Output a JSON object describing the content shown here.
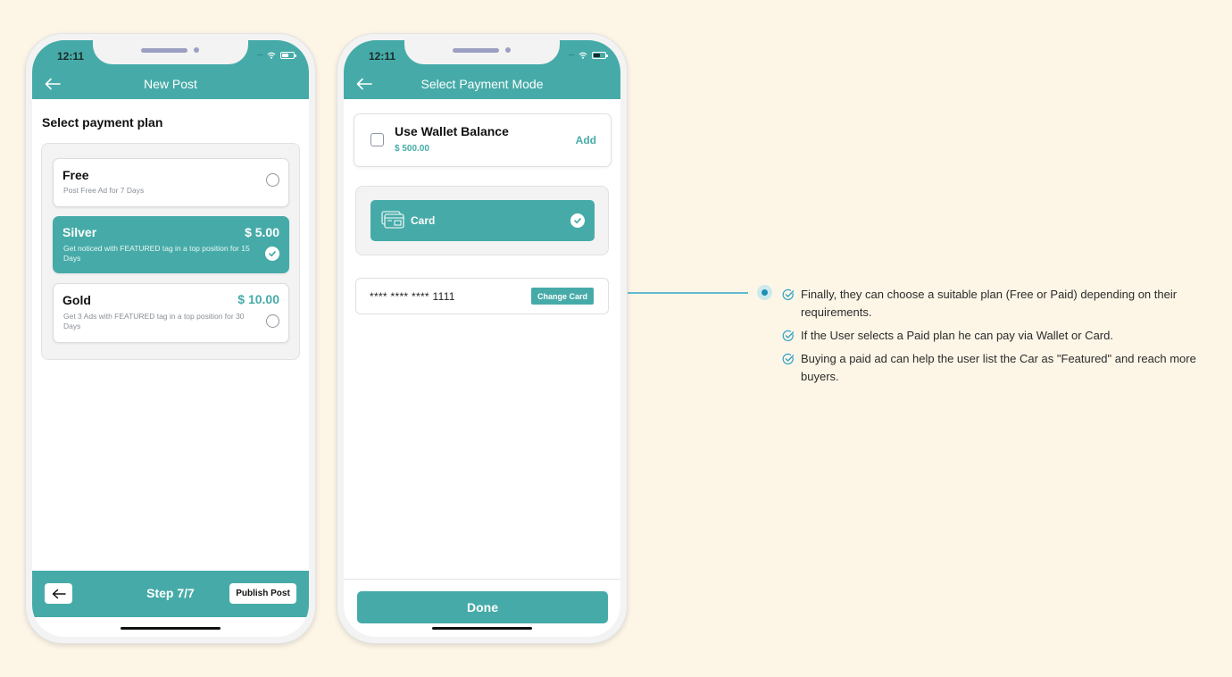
{
  "phone1": {
    "status_time": "12:11",
    "nav_title": "New Post",
    "section_title": "Select payment plan",
    "plans": [
      {
        "name": "Free",
        "price": "",
        "description": "Post Free Ad for 7 Days",
        "selected": false
      },
      {
        "name": "Silver",
        "price": "$ 5.00",
        "description": "Get noticed with FEATURED tag in a top position for 15 Days",
        "selected": true
      },
      {
        "name": "Gold",
        "price": "$ 10.00",
        "description": "Get 3 Ads with FEATURED tag in a top position for 30 Days",
        "selected": false
      }
    ],
    "footer": {
      "step_label": "Step 7/7",
      "publish_label": "Publish Post"
    }
  },
  "phone2": {
    "status_time": "12:11",
    "nav_title": "Select Payment Mode",
    "wallet": {
      "title": "Use Wallet Balance",
      "amount": "$ 500.00",
      "add_label": "Add",
      "checked": false
    },
    "card_option": {
      "label": "Card",
      "selected": true
    },
    "saved_card": {
      "number": "**** **** **** 1111",
      "change_label": "Change Card"
    },
    "done_label": "Done"
  },
  "annotation": {
    "notes": [
      "Finally, they can choose a suitable plan (Free or Paid) depending on their requirements.",
      "If the User selects a Paid plan he can pay via Wallet or Card.",
      "Buying a paid ad can help the user list the Car as \"Featured\" and reach more buyers."
    ]
  },
  "colors": {
    "accent": "#46aba8",
    "background": "#fdf6e7",
    "connector": "#62b8cf"
  }
}
